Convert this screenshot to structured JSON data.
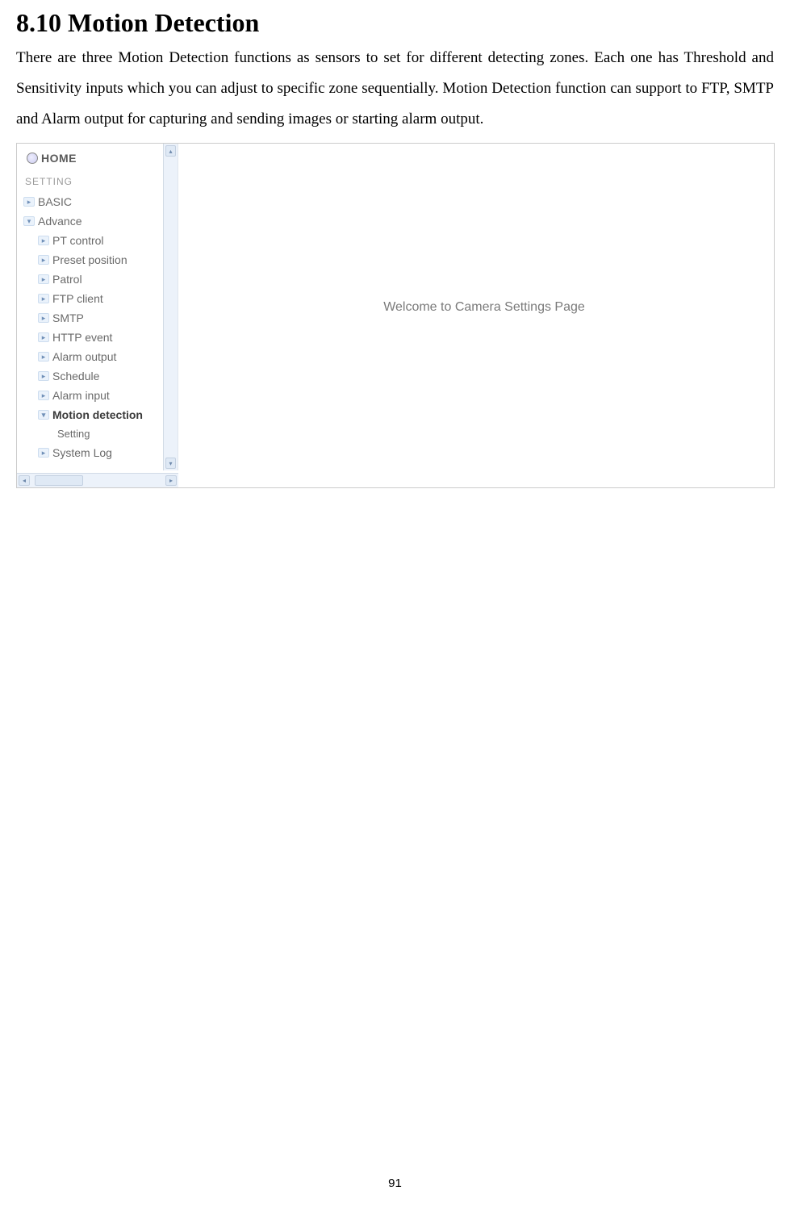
{
  "section_title": "8.10 Motion Detection",
  "body_text": "There are three Motion Detection functions as sensors to set for different detecting zones. Each one has Threshold and Sensitivity inputs which you can adjust to specific zone sequentially. Motion Detection function can support to FTP, SMTP and Alarm output for capturing and sending images or starting alarm output.",
  "page_number": "91",
  "screenshot": {
    "home_label": "HOME",
    "section_label": "SETTING",
    "basic_label": "BASIC",
    "advance_label": "Advance",
    "menu": {
      "pt_control": "PT control",
      "preset_position": "Preset position",
      "patrol": "Patrol",
      "ftp_client": "FTP client",
      "smtp": "SMTP",
      "http_event": "HTTP event",
      "alarm_output": "Alarm output",
      "schedule": "Schedule",
      "alarm_input": "Alarm input",
      "motion_detection": "Motion detection",
      "setting": "Setting",
      "system_log": "System Log"
    },
    "welcome_text": "Welcome to Camera Settings Page"
  }
}
